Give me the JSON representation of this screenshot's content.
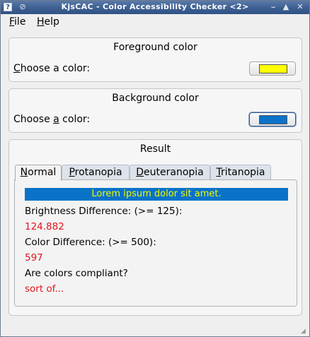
{
  "window": {
    "title": "KjsCAC - Color Accessibility Checker <2>",
    "app_icon": "?",
    "pin_icon": "⊘",
    "min_icon": "⌣",
    "max_icon": "▲",
    "close_icon": "✕"
  },
  "menu": {
    "file_hotkey": "F",
    "file_rest": "ile",
    "help_hotkey": "H",
    "help_rest": "elp"
  },
  "foreground": {
    "title": "Foreground color",
    "label_pre": "",
    "label_hotkey": "C",
    "label_post": "hoose a color:",
    "color": "#ffff00"
  },
  "background": {
    "title": "Background color",
    "label_pre": "Choose ",
    "label_hotkey": "a",
    "label_post": " color:",
    "color": "#0a73c8"
  },
  "result": {
    "title": "Result",
    "tabs": [
      {
        "hotkey": "N",
        "rest": "ormal"
      },
      {
        "hotkey": "P",
        "rest": "rotanopia"
      },
      {
        "hotkey": "D",
        "rest": "euteranopia"
      },
      {
        "hotkey": "T",
        "rest": "ritanopia"
      }
    ],
    "active_tab": "Normal",
    "sample_text": "Lorem ipsum dolor sit amet.",
    "brightness_label": "Brightness Difference: (>= 125):",
    "brightness_value": "124.882",
    "color_diff_label": "Color Difference: (>= 500):",
    "color_diff_value": "597",
    "compliant_label": "Are colors compliant?",
    "compliant_value": "sort of..."
  },
  "colors": {
    "titlebar": "#3f6193",
    "sample_bg": "#0a73c8",
    "sample_fg": "#f3f900",
    "value_red": "#e0141e"
  }
}
